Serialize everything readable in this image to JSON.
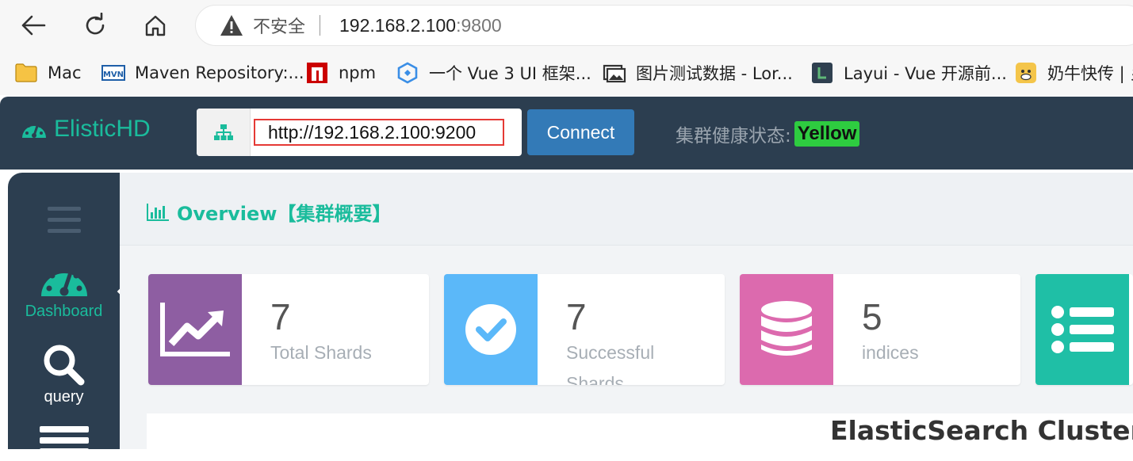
{
  "browser": {
    "security_text": "不安全",
    "url_host": "192.168.2.100",
    "url_port": ":9800",
    "bookmarks": [
      {
        "label": "Mac",
        "icon": "folder-icon"
      },
      {
        "label": "Maven Repository:...",
        "icon": "maven-icon"
      },
      {
        "label": "npm",
        "icon": "npm-icon"
      },
      {
        "label": "一个 Vue 3 UI 框架...",
        "icon": "vue-ui-icon"
      },
      {
        "label": "图片测试数据 - Lor...",
        "icon": "image-icon"
      },
      {
        "label": "Layui - Vue 开源前...",
        "icon": "layui-icon"
      },
      {
        "label": "奶牛快传 | 乡",
        "icon": "cow-icon"
      }
    ]
  },
  "header": {
    "brand": "ElisticHD",
    "connection_url": "http://192.168.2.100:9200",
    "connect_label": "Connect",
    "health_label": "集群健康状态:",
    "health_value": "Yellow",
    "health_color": "#2ecc40"
  },
  "sidebar": {
    "items": [
      {
        "label": "Dashboard",
        "icon": "dashboard-icon",
        "active": true
      },
      {
        "label": "query",
        "icon": "search-icon"
      }
    ]
  },
  "main": {
    "title": "Overview【集群概要】",
    "stats": [
      {
        "value": "7",
        "label": "Total Shards",
        "color": "#8e5ea2",
        "icon": "trend-chart-icon"
      },
      {
        "value": "7",
        "label": "Successful Shards",
        "color": "#5bb8f9",
        "icon": "check-circle-icon"
      },
      {
        "value": "5",
        "label": "indices",
        "color": "#dc6aae",
        "icon": "database-icon"
      },
      {
        "value": "",
        "label": "",
        "color": "#1fbfa6",
        "icon": "list-icon"
      }
    ],
    "cluster_title": "ElasticSearch Cluster S"
  }
}
